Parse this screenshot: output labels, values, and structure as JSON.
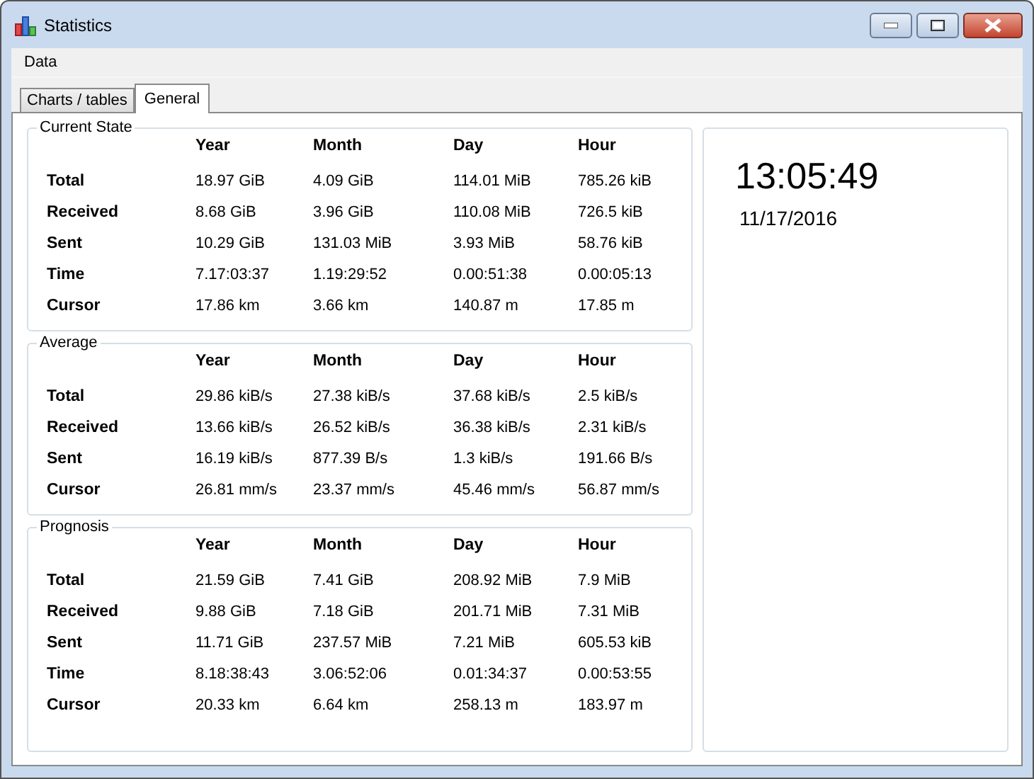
{
  "window": {
    "title": "Statistics"
  },
  "menu": [
    "Data"
  ],
  "tabs": [
    {
      "label": "Charts / tables",
      "selected": false
    },
    {
      "label": "General",
      "selected": true
    }
  ],
  "groups": [
    {
      "title": "Current State",
      "columns": [
        "Year",
        "Month",
        "Day",
        "Hour"
      ],
      "rows": [
        {
          "label": "Total",
          "values": [
            "18.97 GiB",
            "4.09 GiB",
            "114.01 MiB",
            "785.26 kiB"
          ]
        },
        {
          "label": "Received",
          "values": [
            "8.68 GiB",
            "3.96 GiB",
            "110.08 MiB",
            "726.5 kiB"
          ]
        },
        {
          "label": "Sent",
          "values": [
            "10.29 GiB",
            "131.03 MiB",
            "3.93 MiB",
            "58.76 kiB"
          ]
        },
        {
          "label": "Time",
          "values": [
            "7.17:03:37",
            "1.19:29:52",
            "0.00:51:38",
            "0.00:05:13"
          ]
        },
        {
          "label": "Cursor",
          "values": [
            "17.86 km",
            "3.66 km",
            "140.87 m",
            "17.85 m"
          ]
        }
      ]
    },
    {
      "title": "Average",
      "columns": [
        "Year",
        "Month",
        "Day",
        "Hour"
      ],
      "rows": [
        {
          "label": "Total",
          "values": [
            "29.86 kiB/s",
            "27.38 kiB/s",
            "37.68 kiB/s",
            "2.5 kiB/s"
          ]
        },
        {
          "label": "Received",
          "values": [
            "13.66 kiB/s",
            "26.52 kiB/s",
            "36.38 kiB/s",
            "2.31 kiB/s"
          ]
        },
        {
          "label": "Sent",
          "values": [
            "16.19 kiB/s",
            "877.39 B/s",
            "1.3 kiB/s",
            "191.66 B/s"
          ]
        },
        {
          "label": "Cursor",
          "values": [
            "26.81 mm/s",
            "23.37 mm/s",
            "45.46 mm/s",
            "56.87 mm/s"
          ]
        }
      ]
    },
    {
      "title": "Prognosis",
      "columns": [
        "Year",
        "Month",
        "Day",
        "Hour"
      ],
      "rows": [
        {
          "label": "Total",
          "values": [
            "21.59 GiB",
            "7.41 GiB",
            "208.92 MiB",
            "7.9 MiB"
          ]
        },
        {
          "label": "Received",
          "values": [
            "9.88 GiB",
            "7.18 GiB",
            "201.71 MiB",
            "7.31 MiB"
          ]
        },
        {
          "label": "Sent",
          "values": [
            "11.71 GiB",
            "237.57 MiB",
            "7.21 MiB",
            "605.53 kiB"
          ]
        },
        {
          "label": "Time",
          "values": [
            "8.18:38:43",
            "3.06:52:06",
            "0.01:34:37",
            "0.00:53:55"
          ]
        },
        {
          "label": "Cursor",
          "values": [
            "20.33 km",
            "6.64 km",
            "258.13 m",
            "183.97 m"
          ]
        }
      ]
    }
  ],
  "clock": {
    "time": "13:05:49",
    "date": "11/17/2016"
  }
}
